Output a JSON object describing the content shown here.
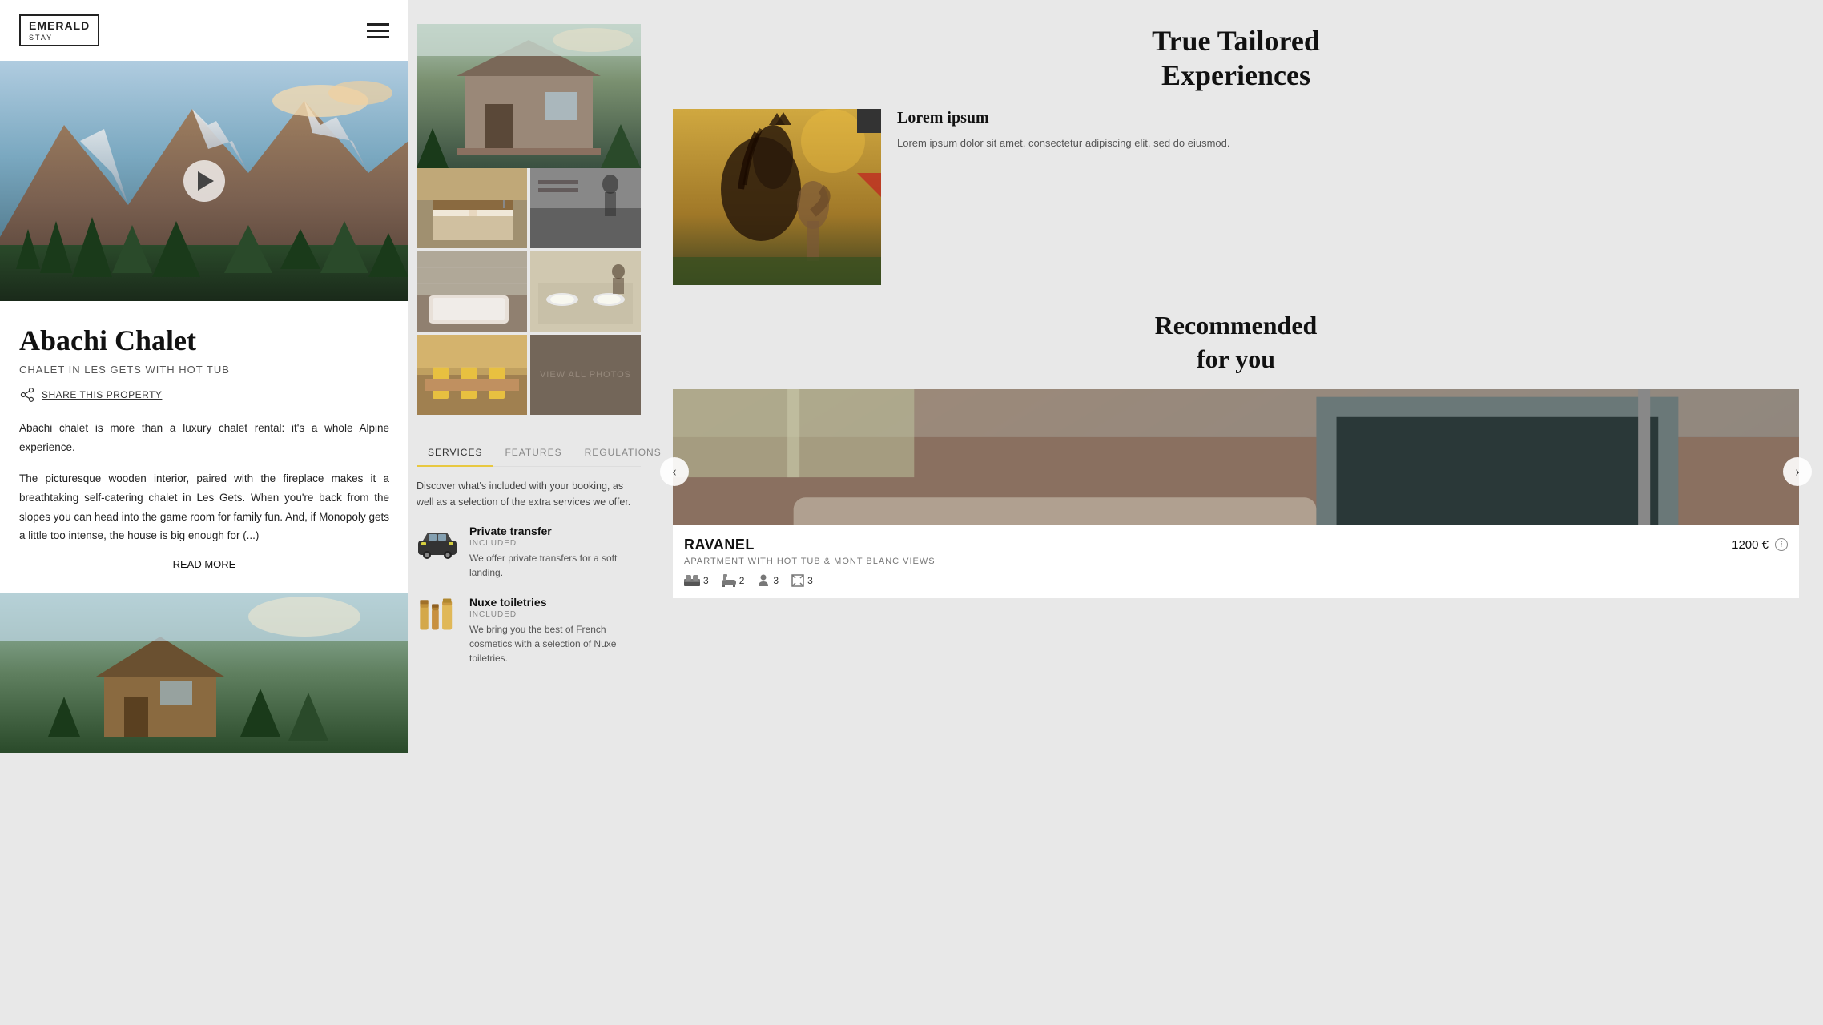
{
  "brand": {
    "name": "EMERALD",
    "subtitle": "STAY",
    "logo_label": "EMERALD STAY"
  },
  "left_panel": {
    "property_title": "Abachi Chalet",
    "property_subtitle": "CHALET IN LES GETS WITH HOT TUB",
    "share_label": "SHARE THIS PROPERTY",
    "description_1": "Abachi chalet is more than a luxury chalet rental: it's a whole Alpine experience.",
    "description_2": "The picturesque wooden interior, paired with the fireplace makes it a breathtaking self-catering chalet in Les Gets. When you're back from the slopes you can head into the game room for family fun. And, if Monopoly gets a little too intense, the house is big enough for (...)",
    "read_more_label": "READ MORE"
  },
  "middle_panel": {
    "view_all_label": "VIEW ALL PHOTOS",
    "tabs": [
      "SERVICES",
      "FEATURES",
      "REGULATIONS"
    ],
    "active_tab": "SERVICES",
    "tab_description": "Discover what's included with your booking, as well as a selection of the extra services we offer.",
    "services": [
      {
        "name": "Private transfer",
        "badge": "INCLUDED",
        "description": "We offer private transfers for a soft landing."
      },
      {
        "name": "Nuxe toiletries",
        "badge": "INCLUDED",
        "description": "We bring you the best of French cosmetics with a selection of Nuxe toiletries."
      }
    ]
  },
  "right_panel": {
    "experiences_title": "True Tailored\nExperiences",
    "experience_name": "Lorem ipsum",
    "experience_desc": "Lorem ipsum dolor sit amet, consectetur adipiscing elit, sed do eiusmod.",
    "recommended_title": "Recommended\nfor you",
    "card": {
      "name": "RAVANEL",
      "price": "1200 €",
      "subtype": "APARTMENT WITH HOT TUB & MONT BLANC VIEWS",
      "amenities": [
        {
          "icon": "bed",
          "value": "3"
        },
        {
          "icon": "bath",
          "value": "2"
        },
        {
          "icon": "person",
          "value": "3"
        },
        {
          "icon": "expand",
          "value": "3"
        }
      ]
    }
  }
}
